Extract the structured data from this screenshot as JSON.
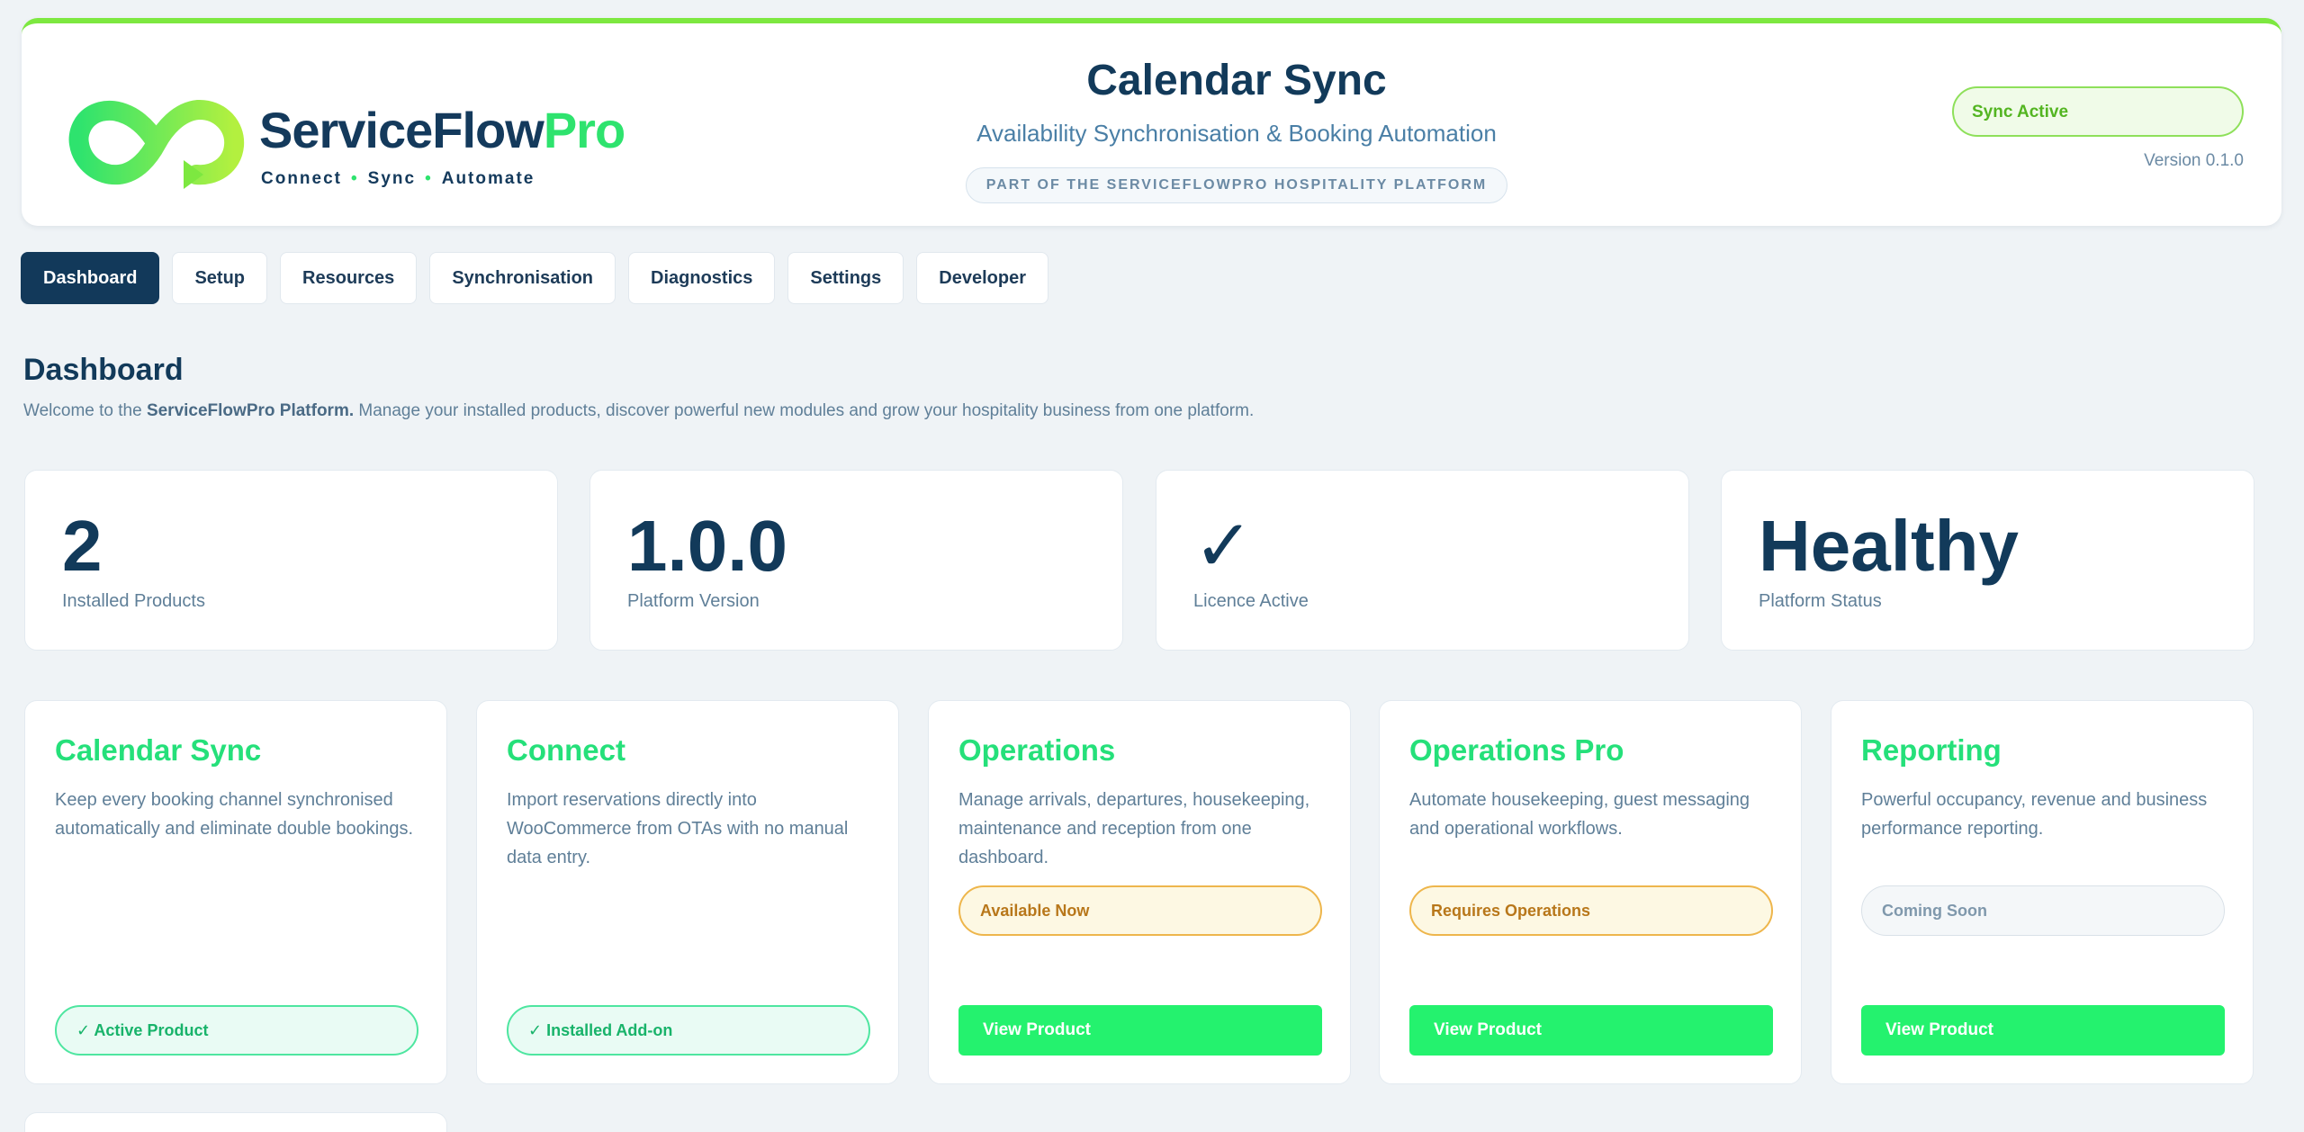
{
  "brand": {
    "name_main": "ServiceFlow",
    "name_accent": "Pro",
    "tagline": [
      "Connect",
      "Sync",
      "Automate"
    ]
  },
  "header": {
    "title": "Calendar Sync",
    "subtitle": "Availability Synchronisation & Booking Automation",
    "platform_badge": "PART OF THE SERVICEFLOWPRO HOSPITALITY PLATFORM",
    "sync_status": "Sync Active",
    "version": "Version 0.1.0"
  },
  "nav": {
    "tabs": [
      "Dashboard",
      "Setup",
      "Resources",
      "Synchronisation",
      "Diagnostics",
      "Settings",
      "Developer"
    ],
    "active": "Dashboard"
  },
  "page": {
    "title": "Dashboard",
    "desc_prefix": "Welcome to the ",
    "desc_bold": "ServiceFlowPro Platform.",
    "desc_suffix": " Manage your installed products, discover powerful new modules and grow your hospitality business from one platform."
  },
  "stats": [
    {
      "value": "2",
      "label": "Installed Products"
    },
    {
      "value": "1.0.0",
      "label": "Platform Version"
    },
    {
      "value": "✓",
      "label": "Licence Active"
    },
    {
      "value": "Healthy",
      "label": "Platform Status"
    }
  ],
  "products": [
    {
      "title": "Calendar Sync",
      "desc": "Keep every booking channel synchronised automatically and eliminate double bookings.",
      "status": "✓ Active Product",
      "status_kind": "green"
    },
    {
      "title": "Connect",
      "desc": "Import reservations directly into WooCommerce from OTAs with no manual data entry.",
      "status": "✓ Installed Add-on",
      "status_kind": "green"
    },
    {
      "title": "Operations",
      "desc": "Manage arrivals, departures, housekeeping, maintenance and reception from one dashboard.",
      "status": "Available Now",
      "status_kind": "amber",
      "button": "View Product"
    },
    {
      "title": "Operations Pro",
      "desc": "Automate housekeeping, guest messaging and operational workflows.",
      "status": "Requires Operations",
      "status_kind": "amber",
      "button": "View Product"
    },
    {
      "title": "Reporting",
      "desc": "Powerful occupancy, revenue and business performance reporting.",
      "status": "Coming Soon",
      "status_kind": "gray",
      "button": "View Product"
    }
  ],
  "colors": {
    "accent_green": "#24f26e",
    "navy": "#12395a",
    "lime": "#7de840",
    "amber": "#eeb64c"
  },
  "icons": {
    "logo": "infinity-loop-logo",
    "check": "check-icon"
  }
}
